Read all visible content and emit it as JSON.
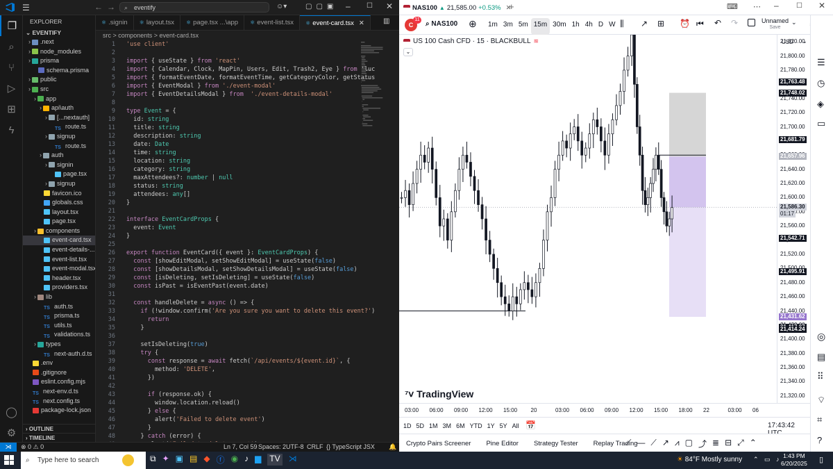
{
  "vscode": {
    "search": "eventify",
    "explorer_title": "EXPLORER",
    "project": "EVENTIFY",
    "tabs": [
      {
        "label": ".signin",
        "active": false
      },
      {
        "label": "layout.tsx",
        "active": false
      },
      {
        "label": "page.tsx ...\\app",
        "active": false
      },
      {
        "label": "event-list.tsx",
        "active": false
      },
      {
        "label": "event-card.tsx",
        "active": true
      }
    ],
    "breadcrumb": "src > components > event-card.tsx",
    "tree": [
      {
        "label": ".next",
        "indent": 1,
        "type": "folder",
        "color": "#6c8ebf"
      },
      {
        "label": "node_modules",
        "indent": 1,
        "type": "folder",
        "color": "#8bc34a"
      },
      {
        "label": "prisma",
        "indent": 1,
        "type": "folder",
        "color": "#26a69a"
      },
      {
        "label": "schema.prisma",
        "indent": 2,
        "type": "file",
        "color": "#5c6bc0"
      },
      {
        "label": "public",
        "indent": 1,
        "type": "folder",
        "color": "#66bb6a"
      },
      {
        "label": "src",
        "indent": 1,
        "type": "folder",
        "color": "#4caf50"
      },
      {
        "label": "app",
        "indent": 2,
        "type": "folder",
        "color": "#4caf50"
      },
      {
        "label": "api\\auth",
        "indent": 3,
        "type": "folder",
        "color": "#ffb300"
      },
      {
        "label": "[...nextauth]",
        "indent": 4,
        "type": "folder",
        "color": "#90a4ae"
      },
      {
        "label": "route.ts",
        "indent": 5,
        "type": "ts",
        "color": "#3178c6"
      },
      {
        "label": "signup",
        "indent": 4,
        "type": "folder",
        "color": "#90a4ae"
      },
      {
        "label": "route.ts",
        "indent": 5,
        "type": "ts",
        "color": "#3178c6"
      },
      {
        "label": "auth",
        "indent": 3,
        "type": "folder",
        "color": "#90a4ae"
      },
      {
        "label": "signin",
        "indent": 4,
        "type": "folder",
        "color": "#90a4ae"
      },
      {
        "label": "page.tsx",
        "indent": 5,
        "type": "file",
        "color": "#4fc3f7"
      },
      {
        "label": "signup",
        "indent": 4,
        "type": "folder",
        "color": "#90a4ae"
      },
      {
        "label": "favicon.ico",
        "indent": 3,
        "type": "file",
        "color": "#fdd835"
      },
      {
        "label": "globals.css",
        "indent": 3,
        "type": "file",
        "color": "#42a5f5"
      },
      {
        "label": "layout.tsx",
        "indent": 3,
        "type": "file",
        "color": "#4fc3f7"
      },
      {
        "label": "page.tsx",
        "indent": 3,
        "type": "file",
        "color": "#4fc3f7"
      },
      {
        "label": "components",
        "indent": 2,
        "type": "folder",
        "color": "#fbc02d"
      },
      {
        "label": "event-card.tsx",
        "indent": 3,
        "type": "file",
        "color": "#4fc3f7",
        "selected": true
      },
      {
        "label": "event-details-...",
        "indent": 3,
        "type": "file",
        "color": "#4fc3f7"
      },
      {
        "label": "event-list.tsx",
        "indent": 3,
        "type": "file",
        "color": "#4fc3f7"
      },
      {
        "label": "event-modal.tsx",
        "indent": 3,
        "type": "file",
        "color": "#4fc3f7"
      },
      {
        "label": "header.tsx",
        "indent": 3,
        "type": "file",
        "color": "#4fc3f7"
      },
      {
        "label": "providers.tsx",
        "indent": 3,
        "type": "file",
        "color": "#4fc3f7"
      },
      {
        "label": "lib",
        "indent": 2,
        "type": "folder",
        "color": "#a1887f"
      },
      {
        "label": "auth.ts",
        "indent": 3,
        "type": "ts",
        "color": "#3178c6"
      },
      {
        "label": "prisma.ts",
        "indent": 3,
        "type": "ts",
        "color": "#3178c6"
      },
      {
        "label": "utils.ts",
        "indent": 3,
        "type": "ts",
        "color": "#3178c6"
      },
      {
        "label": "validations.ts",
        "indent": 3,
        "type": "ts",
        "color": "#3178c6"
      },
      {
        "label": "types",
        "indent": 2,
        "type": "folder",
        "color": "#26a69a"
      },
      {
        "label": "next-auth.d.ts",
        "indent": 3,
        "type": "ts",
        "color": "#3178c6"
      },
      {
        "label": ".env",
        "indent": 1,
        "type": "file",
        "color": "#fdd835"
      },
      {
        "label": ".gitignore",
        "indent": 1,
        "type": "file",
        "color": "#e64a19"
      },
      {
        "label": "eslint.config.mjs",
        "indent": 1,
        "type": "file",
        "color": "#7e57c2"
      },
      {
        "label": "next-env.d.ts",
        "indent": 1,
        "type": "ts",
        "color": "#3178c6"
      },
      {
        "label": "next.config.ts",
        "indent": 1,
        "type": "ts",
        "color": "#3178c6"
      },
      {
        "label": "package-lock.json",
        "indent": 1,
        "type": "file",
        "color": "#e53935"
      }
    ],
    "outline": "OUTLINE",
    "timeline": "TIMELINE",
    "code": [
      "'use client'",
      "",
      "import { useState } from 'react'",
      "import { Calendar, Clock, MapPin, Users, Edit, Trash2, Eye } from 'luc",
      "import { formatEventDate, formatEventTime, getCategoryColor, getStatus",
      "import { EventModal } from './event-modal'",
      "import { EventDetailsModal } from  './event-details-modal'",
      "",
      "type Event = {",
      "  id: string",
      "  title: string",
      "  description: string",
      "  date: Date",
      "  time: string",
      "  location: string",
      "  category: string",
      "  maxAttendees?: number | null",
      "  status: string",
      "  attendees: any[]",
      "}",
      "",
      "interface EventCardProps {",
      "  event: Event",
      "}",
      "",
      "export function EventCard({ event }: EventCardProps) {",
      "  const [showEditModal, setShowEditModal] = useState(false)",
      "  const [showDetailsModal, setShowDetailsModal] = useState(false)",
      "  const [isDeleting, setIsDeleting] = useState(false)",
      "  const isPast = isEventPast(event.date)",
      "",
      "  const handleDelete = async () => {",
      "    if (!window.confirm('Are you sure you want to delete this event?')",
      "      return",
      "    }",
      "",
      "    setIsDeleting(true)",
      "    try {",
      "      const response = await fetch(`/api/events/${event.id}`, {",
      "        method: 'DELETE',",
      "      })",
      "",
      "      if (response.ok) {",
      "        window.location.reload()",
      "      } else {",
      "        alert('Failed to delete event')",
      "      }",
      "    } catch (error) {",
      "      alert('Failed to delete event')"
    ],
    "status": {
      "errors": "0",
      "warnings": "0",
      "position": "Ln 7, Col 59",
      "spaces": "Spaces: 2",
      "encoding": "UTF-8",
      "eol": "CRLF",
      "language": "TypeScript JSX"
    }
  },
  "tv": {
    "tab_label": "NAS100",
    "tab_price": "21,585.00",
    "tab_change": "+0.53%",
    "symbol": "NAS100",
    "badge": "11",
    "intervals": [
      "1m",
      "3m",
      "5m",
      "15m",
      "30m",
      "1h",
      "4h",
      "D",
      "W"
    ],
    "active_interval": "15m",
    "layout_name": "Unnamed",
    "layout_status": "Save",
    "legend": "US 100 Cash CFD · 15 · BLACKBULL",
    "currency": "USD",
    "logo": "TradingView",
    "price_ticks": [
      "21,820.00",
      "21,800.00",
      "21,780.00",
      "21,760.00",
      "21,740.00",
      "21,720.00",
      "21,700.00",
      "21,680.00",
      "21,660.00",
      "21,640.00",
      "21,620.00",
      "21,600.00",
      "21,580.00",
      "21,560.00",
      "21,540.00",
      "21,520.00",
      "21,500.00",
      "21,480.00",
      "21,460.00",
      "21,440.00",
      "21,420.00",
      "21,400.00",
      "21,380.00",
      "21,360.00",
      "21,340.00",
      "21,320.00"
    ],
    "price_badges": [
      {
        "label": "21,763.48",
        "value": 21763.48,
        "bg": "#131722",
        "fg": "#ffffff"
      },
      {
        "label": "21,748.02",
        "value": 21748.02,
        "bg": "#131722",
        "fg": "#ffffff"
      },
      {
        "label": "21,681.79",
        "value": 21681.79,
        "bg": "#131722",
        "fg": "#ffffff"
      },
      {
        "label": "21,657.96",
        "value": 21657.96,
        "bg": "#b2b5be",
        "fg": "#ffffff"
      },
      {
        "label": "21,586.30",
        "value": 21586.3,
        "bg": "#d1d4dc",
        "fg": "#131722"
      },
      {
        "label": "21,542.71",
        "value": 21542.71,
        "bg": "#131722",
        "fg": "#ffffff"
      },
      {
        "label": "21,495.91",
        "value": 21495.91,
        "bg": "#131722",
        "fg": "#ffffff"
      },
      {
        "label": "21,431.62",
        "value": 21431.62,
        "bg": "#9575cd",
        "fg": "#ffffff"
      },
      {
        "label": "21,417.07",
        "value": 21417.07,
        "bg": "#131722",
        "fg": "#ffffff"
      },
      {
        "label": "21,414.24",
        "value": 21414.24,
        "bg": "#131722",
        "fg": "#ffffff"
      }
    ],
    "countdown": "01:17",
    "time_ticks": [
      "03:00",
      "06:00",
      "09:00",
      "12:00",
      "15:00",
      "20",
      "03:00",
      "06:00",
      "09:00",
      "12:00",
      "15:00",
      "18:00",
      "22",
      "03:00",
      "06"
    ],
    "ranges": [
      "1D",
      "5D",
      "1M",
      "3M",
      "6M",
      "YTD",
      "1Y",
      "5Y",
      "All"
    ],
    "clock": "17:43:42 UTC",
    "bottom_tabs": [
      "Crypto Pairs Screener",
      "Pine Editor",
      "Strategy Tester",
      "Replay Trading"
    ]
  },
  "chart_data": {
    "type": "candlestick",
    "ylim": [
      21310,
      21830
    ],
    "close_series": [
      21600,
      21610,
      21590,
      21620,
      21640,
      21660,
      21650,
      21670,
      21640,
      21600,
      21560,
      21570,
      21540,
      21580,
      21610,
      21640,
      21660,
      21650,
      21630,
      21610,
      21590,
      21570,
      21540,
      21520,
      21500,
      21480,
      21460,
      21450,
      21440,
      21460,
      21450,
      21470,
      21480,
      21470,
      21460,
      21480,
      21500,
      21540,
      21580,
      21600,
      21640,
      21660,
      21680,
      21670,
      21690,
      21700,
      21680,
      21660,
      21670,
      21690,
      21710,
      21700,
      21680,
      21660,
      21690,
      21710,
      21730,
      21750,
      21780,
      21800,
      21830,
      21760,
      21700,
      21660,
      21610,
      21590,
      21600,
      21620,
      21640,
      21660,
      21640,
      21600,
      21580,
      21560,
      21570,
      21586
    ],
    "positions": [
      {
        "kind": "stop",
        "top": 21748.02,
        "bottom": 21657.96,
        "color": "#cccccc"
      },
      {
        "kind": "target",
        "top": 21657.96,
        "bottom": 21586.3,
        "color": "#c8b5ea"
      },
      {
        "kind": "target2",
        "top": 21586.3,
        "bottom": 21431.62,
        "color": "#e1d7f4"
      }
    ],
    "hline": 21440
  },
  "taskbar": {
    "search_placeholder": "Type here to search",
    "weather": "84°F  Mostly sunny",
    "time": "1:43 PM",
    "date": "6/20/2025"
  }
}
